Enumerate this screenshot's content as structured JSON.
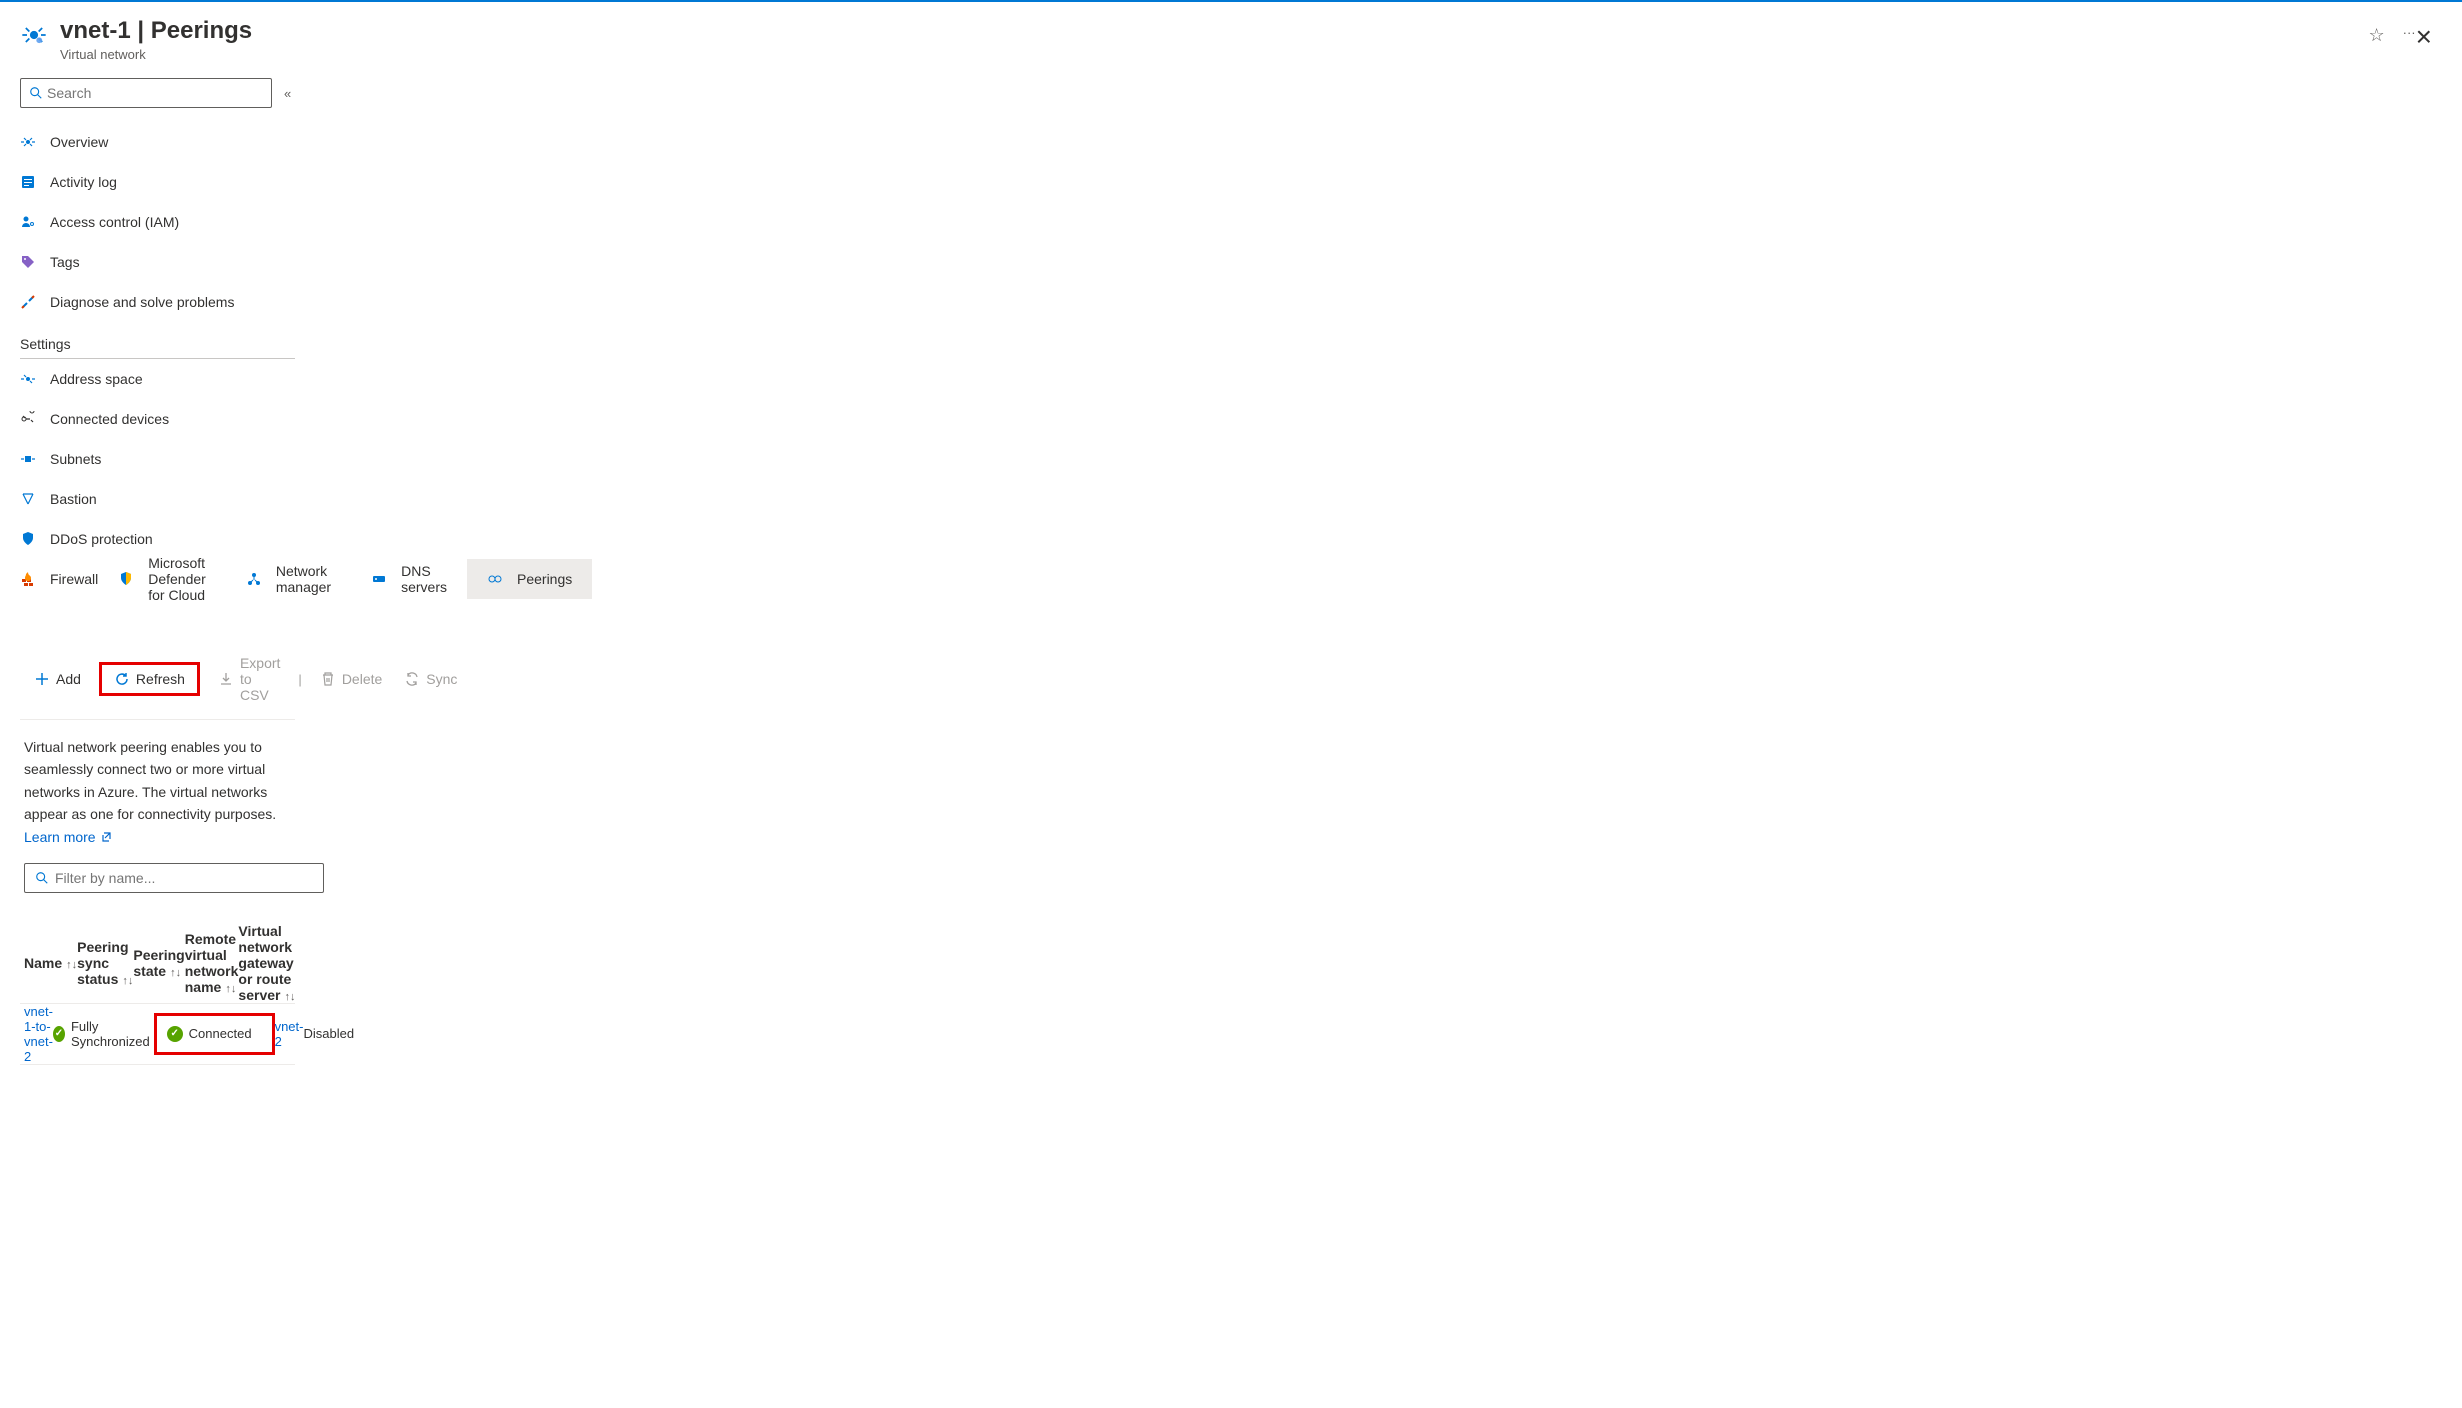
{
  "header": {
    "title": "vnet-1 | Peerings",
    "subtitle": "Virtual network"
  },
  "sidebar": {
    "search_placeholder": "Search",
    "nav_top": [
      {
        "label": "Overview"
      },
      {
        "label": "Activity log"
      },
      {
        "label": "Access control (IAM)"
      },
      {
        "label": "Tags"
      },
      {
        "label": "Diagnose and solve problems"
      }
    ],
    "section_settings": "Settings",
    "nav_settings": [
      {
        "label": "Address space"
      },
      {
        "label": "Connected devices"
      },
      {
        "label": "Subnets"
      },
      {
        "label": "Bastion"
      },
      {
        "label": "DDoS protection"
      },
      {
        "label": "Firewall"
      },
      {
        "label": "Microsoft Defender for Cloud"
      },
      {
        "label": "Network manager"
      },
      {
        "label": "DNS servers"
      },
      {
        "label": "Peerings"
      }
    ]
  },
  "toolbar": {
    "add": "Add",
    "refresh": "Refresh",
    "export_csv": "Export to CSV",
    "delete": "Delete",
    "sync": "Sync"
  },
  "info": {
    "text": "Virtual network peering enables you to seamlessly connect two or more virtual networks in Azure. The virtual networks appear as one for connectivity purposes.",
    "learn_more": "Learn more"
  },
  "filter": {
    "placeholder": "Filter by name..."
  },
  "table": {
    "headers": {
      "name": "Name",
      "sync": "Peering sync status",
      "state": "Peering state",
      "remote": "Remote virtual network name",
      "gateway": "Virtual network gateway or route server"
    },
    "rows": [
      {
        "name": "vnet-1-to-vnet-2",
        "sync": "Fully Synchronized",
        "state": "Connected",
        "remote": "vnet-2",
        "gateway": "Disabled"
      }
    ]
  }
}
